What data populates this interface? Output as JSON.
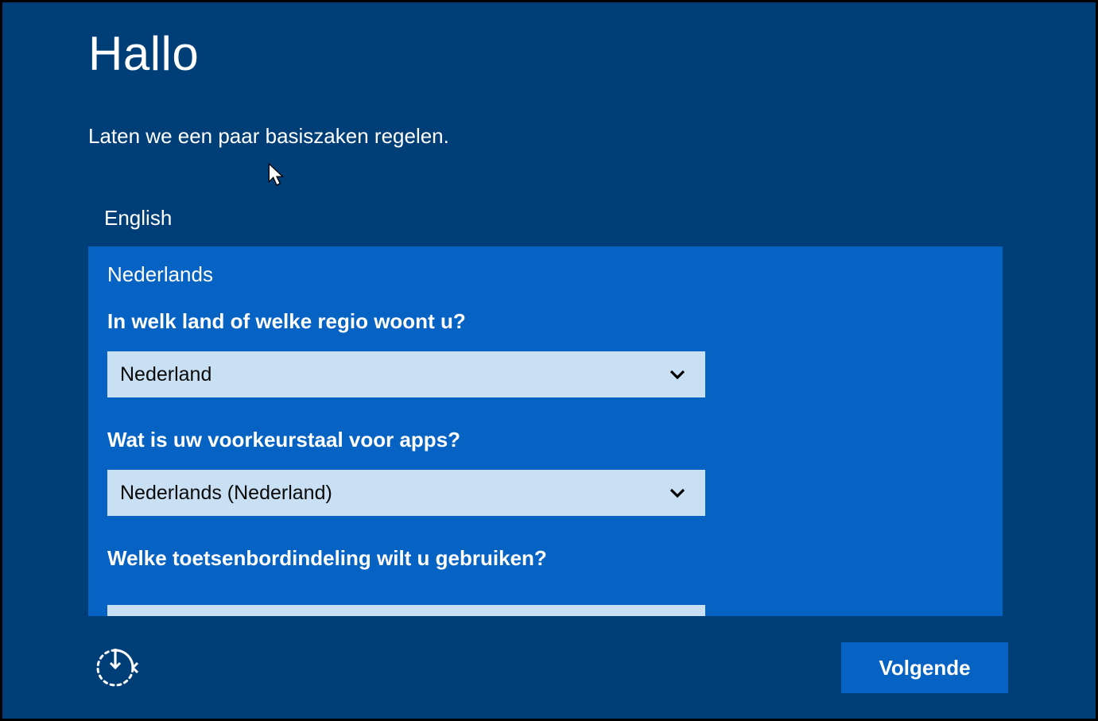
{
  "title": "Hallo",
  "subtitle": "Laten we een paar basiszaken regelen.",
  "languages": {
    "option_english": "English",
    "selected": "Nederlands"
  },
  "questions": {
    "country_region": {
      "label": "In welk land of welke regio woont u?",
      "value": "Nederland"
    },
    "app_language": {
      "label": "Wat is uw voorkeurstaal voor apps?",
      "value": "Nederlands (Nederland)"
    },
    "keyboard_layout": {
      "label": "Welke toetsenbordindeling wilt u gebruiken?"
    }
  },
  "buttons": {
    "next": "Volgende"
  },
  "colors": {
    "background": "#003e77",
    "panel": "#0663c4",
    "dropdown": "#c8dff4"
  }
}
